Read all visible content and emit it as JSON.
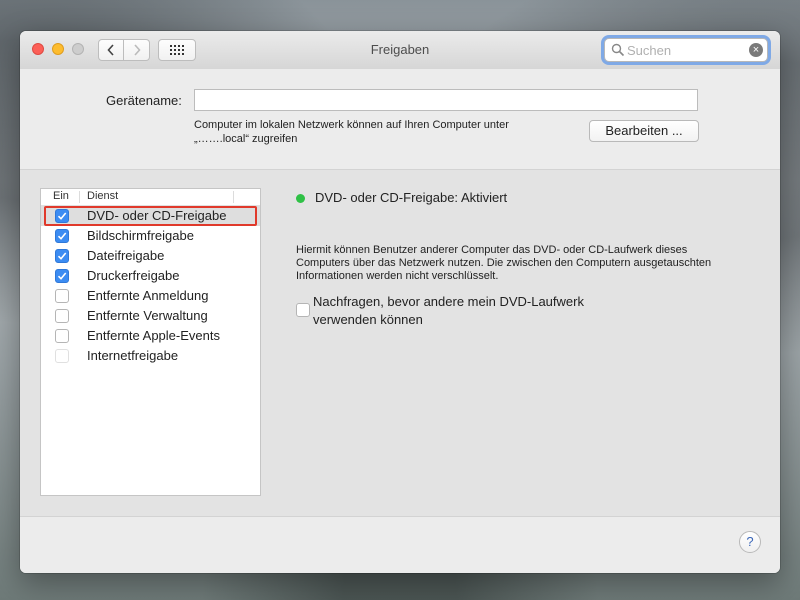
{
  "window": {
    "title": "Freigaben",
    "search": {
      "placeholder": "Suchen",
      "value": ""
    }
  },
  "header": {
    "device_name_label": "Gerätename:",
    "device_name_value": "",
    "network_note_line1": "Computer im lokalen Netzwerk können auf Ihren Computer unter",
    "network_note_line2": "„…….local“ zugreifen",
    "edit_button": "Bearbeiten ..."
  },
  "services": {
    "column_on": "Ein",
    "column_service": "Dienst",
    "items": [
      {
        "label": "DVD- oder CD-Freigabe",
        "checked": true,
        "selected": true
      },
      {
        "label": "Bildschirmfreigabe",
        "checked": true
      },
      {
        "label": "Dateifreigabe",
        "checked": true
      },
      {
        "label": "Druckerfreigabe",
        "checked": true
      },
      {
        "label": "Entfernte Anmeldung",
        "checked": false
      },
      {
        "label": "Entfernte Verwaltung",
        "checked": false
      },
      {
        "label": "Entfernte Apple-Events",
        "checked": false
      },
      {
        "label": "Internetfreigabe",
        "checked": false,
        "disabled": true
      }
    ]
  },
  "detail": {
    "status": "DVD- oder CD-Freigabe: Aktiviert",
    "status_color": "#2fc146",
    "description": "Hiermit können Benutzer anderer Computer das DVD- oder CD-Laufwerk dieses Computers über das Netzwerk nutzen. Die zwischen den Computern ausgetauschten Informationen werden nicht verschlüsselt.",
    "ask_option_label": "Nachfragen, bevor andere mein DVD-Laufwerk verwenden können",
    "ask_option_checked": false
  },
  "footer": {
    "help_label": "?"
  },
  "colors": {
    "accent": "#3c8cf2",
    "highlight": "#e0392b"
  }
}
